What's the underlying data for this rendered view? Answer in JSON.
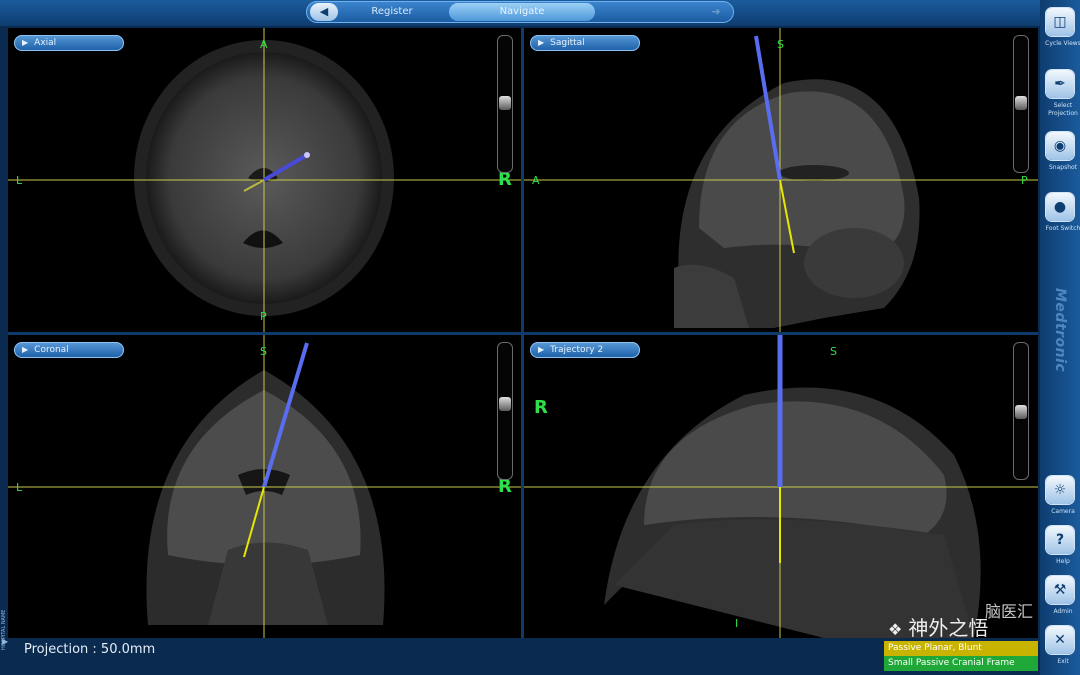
{
  "workflow": {
    "tabs": [
      {
        "label": "Register",
        "active": false
      },
      {
        "label": "Navigate",
        "active": true
      }
    ],
    "back_icon": "back-arrow-icon",
    "forward_icon": "forward-arrow-icon"
  },
  "viewports": {
    "axial": {
      "title": "Axial",
      "labels": {
        "top": "A",
        "left": "L",
        "right": "R",
        "bottom": "P"
      }
    },
    "sagittal": {
      "title": "Sagittal",
      "labels": {
        "top": "S",
        "left": "A",
        "right": "P"
      }
    },
    "coronal": {
      "title": "Coronal",
      "labels": {
        "top": "S",
        "left": "L",
        "right": "R"
      }
    },
    "trajectory": {
      "title": "Trajectory 2",
      "labels": {
        "top": "S",
        "side": "R",
        "bottom": "I"
      }
    }
  },
  "sidebar": {
    "buttons": [
      {
        "label": "Cycle Views",
        "icon": "cycle-views-icon"
      },
      {
        "label": "Select Projection",
        "icon": "select-projection-icon"
      },
      {
        "label": "Snapshot",
        "icon": "camera-snapshot-icon"
      },
      {
        "label": "Foot Switch",
        "icon": "foot-switch-icon"
      },
      {
        "label": "Camera",
        "icon": "tracking-camera-icon"
      },
      {
        "label": "Help",
        "icon": "help-icon"
      },
      {
        "label": "Admin",
        "icon": "wrench-icon"
      },
      {
        "label": "Exit",
        "icon": "close-icon"
      }
    ],
    "brand": "Medtronic"
  },
  "status": {
    "projection": "Projection : 50.0mm",
    "tools": [
      {
        "label": "Passive Planar, Blunt",
        "color": "#c8b400"
      },
      {
        "label": "Small Passive Cranial Frame",
        "color": "#1fa838"
      }
    ]
  },
  "left_panel_label": "HOSPITAL NAME",
  "watermark": {
    "text": "神外之悟",
    "small": "脑医汇"
  },
  "colors": {
    "crosshair": "#c9c94a",
    "trajectory": "#5a6cf0",
    "tip": "#e6e600",
    "orientation": "#2fe04a"
  }
}
